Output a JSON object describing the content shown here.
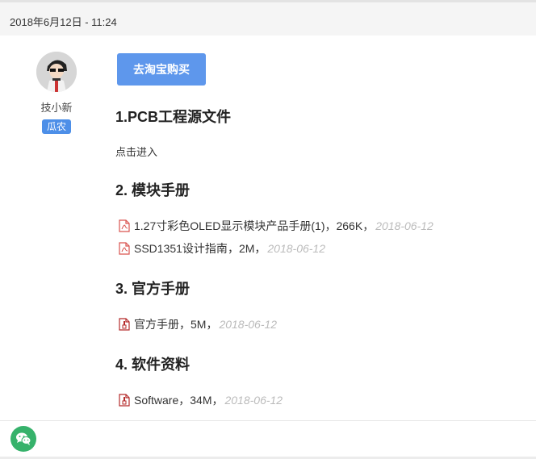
{
  "post": {
    "date": "2018年6月12日 - 11:24"
  },
  "author": {
    "name": "技小新",
    "badge": "瓜农"
  },
  "content": {
    "buy_button": "去淘宝购买",
    "sections": [
      {
        "title": "1.PCB工程源文件",
        "link": "点击进入"
      },
      {
        "title": "2. 模块手册"
      },
      {
        "title": "3. 官方手册"
      },
      {
        "title": "4. 软件资料"
      }
    ],
    "files": [
      {
        "name": "1.27寸彩色OLED显示模块产品手册(1)",
        "size": "266K",
        "date": "2018-06-12",
        "icon": "pdf-file-icon"
      },
      {
        "name": "SSD1351设计指南",
        "size": "2M",
        "date": "2018-06-12",
        "icon": "pdf-file-icon"
      },
      {
        "name": "官方手册",
        "size": "5M",
        "date": "2018-06-12",
        "icon": "archive-file-icon"
      },
      {
        "name": "Software",
        "size": "34M",
        "date": "2018-06-12",
        "icon": "archive-file-icon"
      }
    ],
    "sep": "，"
  },
  "footer": {
    "share_icon": "wechat-icon",
    "accent_color": "#36b26b"
  }
}
